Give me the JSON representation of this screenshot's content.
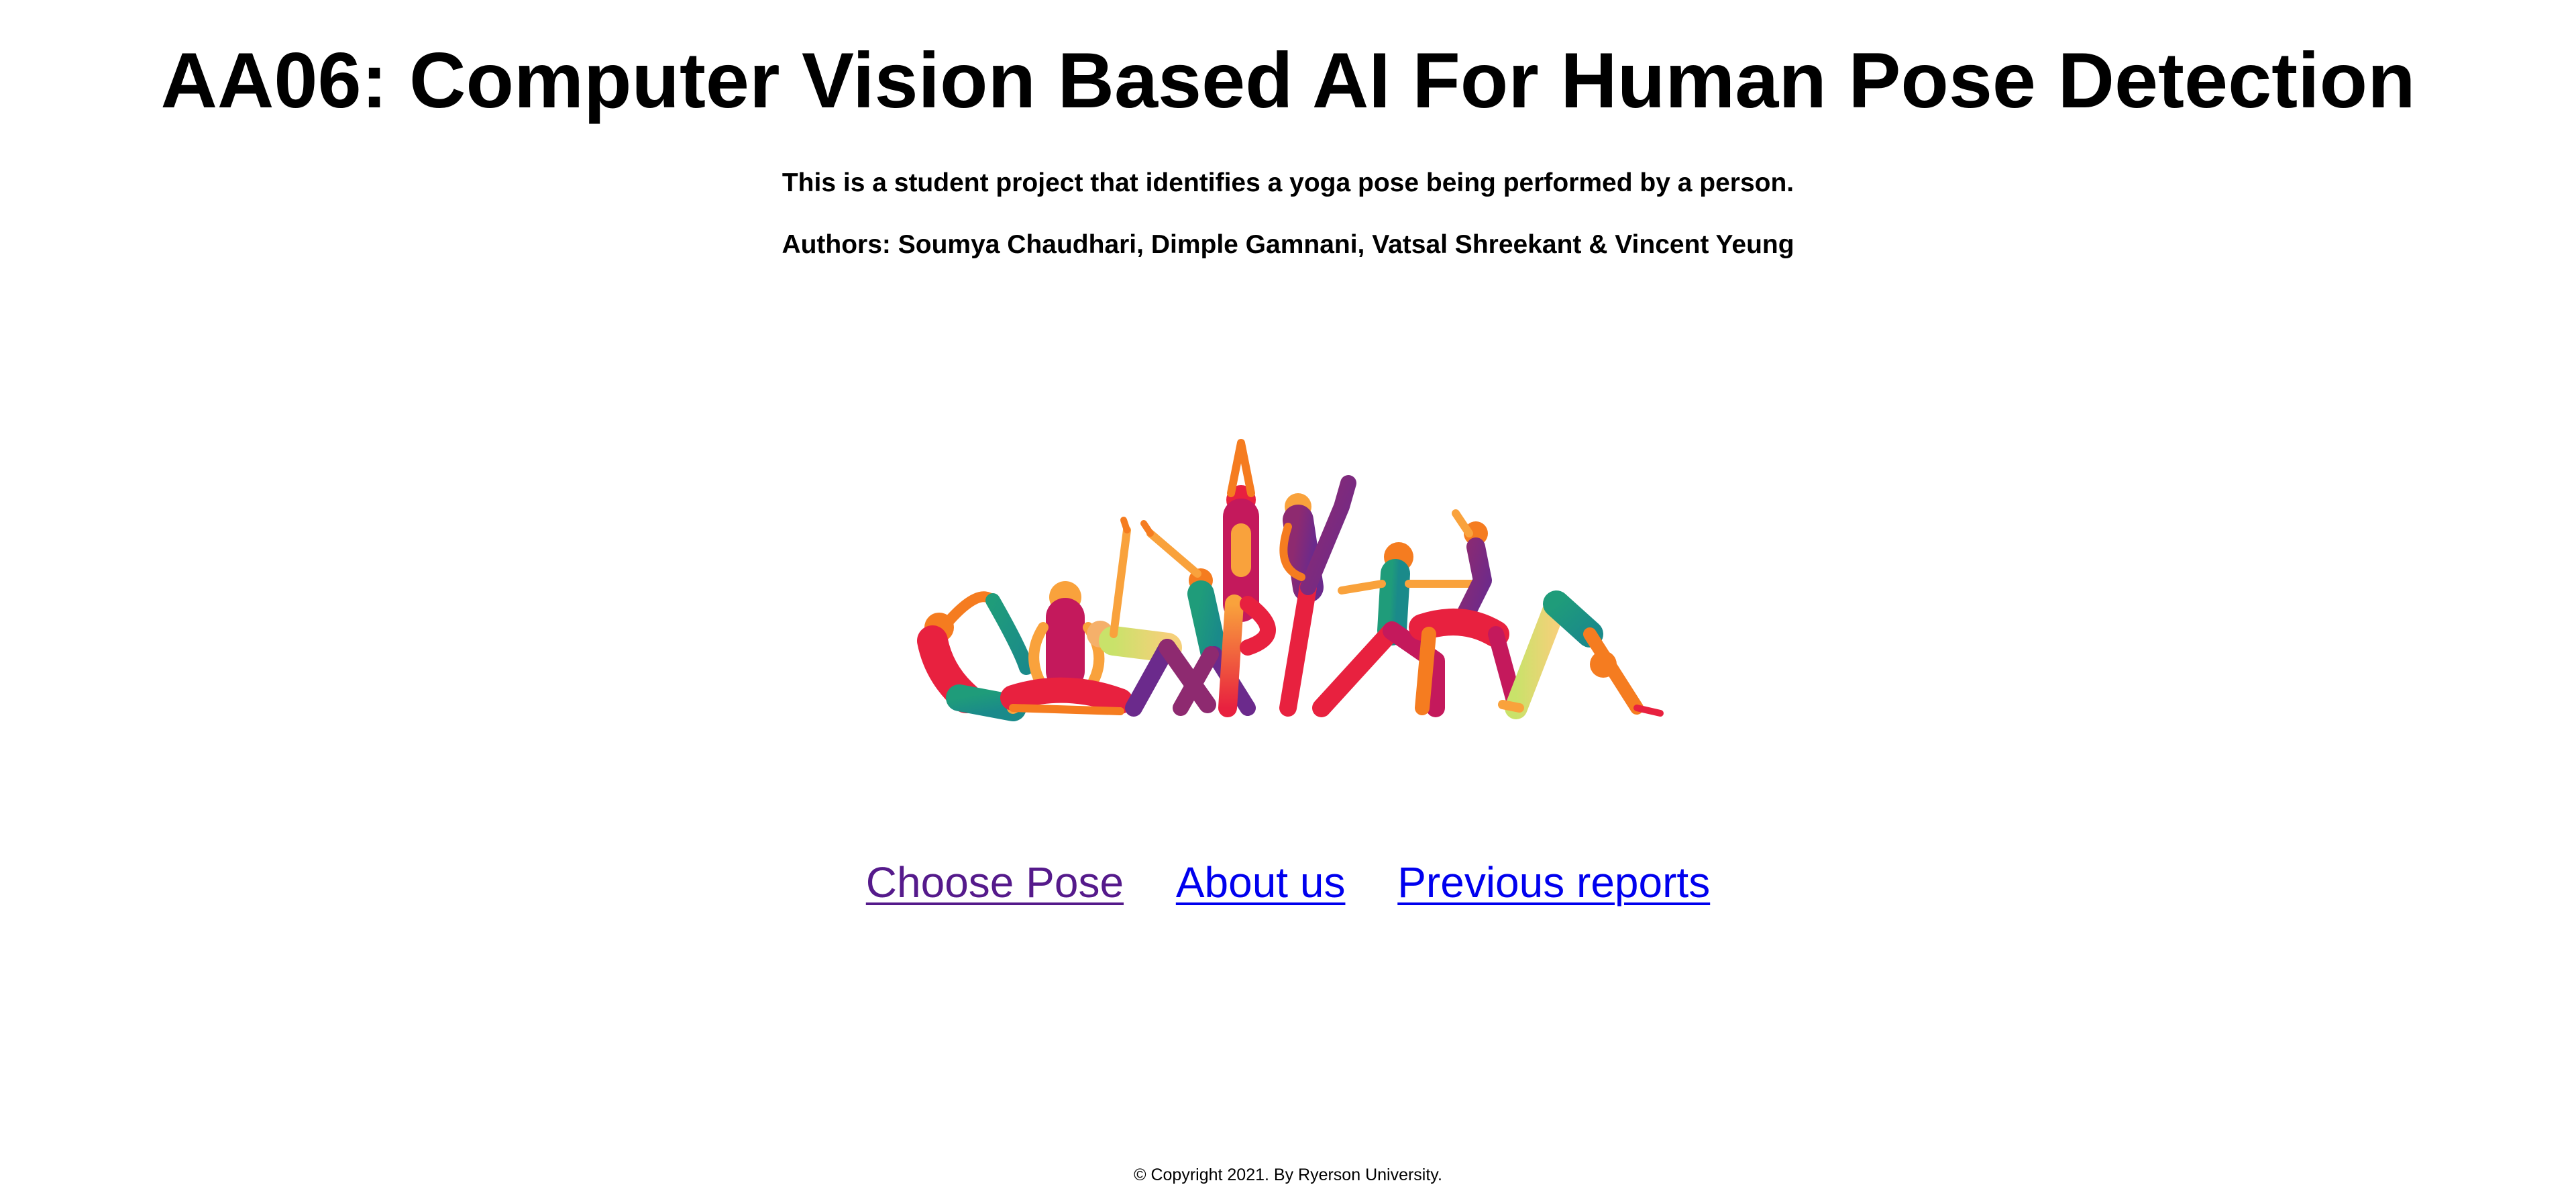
{
  "header": {
    "title": "AA06: Computer Vision Based AI For Human Pose Detection",
    "subtitle": "This is a student project that identifies a yoga pose being performed by a person.",
    "authors": "Authors: Soumya Chaudhari, Dimple Gamnani, Vatsal Shreekant & Vincent Yeung"
  },
  "nav": {
    "links": [
      {
        "label": "Choose Pose",
        "visited": true
      },
      {
        "label": "About us",
        "visited": false
      },
      {
        "label": "Previous reports",
        "visited": false
      }
    ]
  },
  "footer": {
    "copyright": "© Copyright 2021. By Ryerson University."
  },
  "colors": {
    "link": "#0000ee",
    "visited_link": "#551a8b",
    "palette": [
      "#e8213f",
      "#f57c20",
      "#f9a23c",
      "#c4195c",
      "#8e2a70",
      "#6b2a8c",
      "#1a8a8a",
      "#1f9c7a",
      "#c9e26a",
      "#f0b89a"
    ]
  }
}
